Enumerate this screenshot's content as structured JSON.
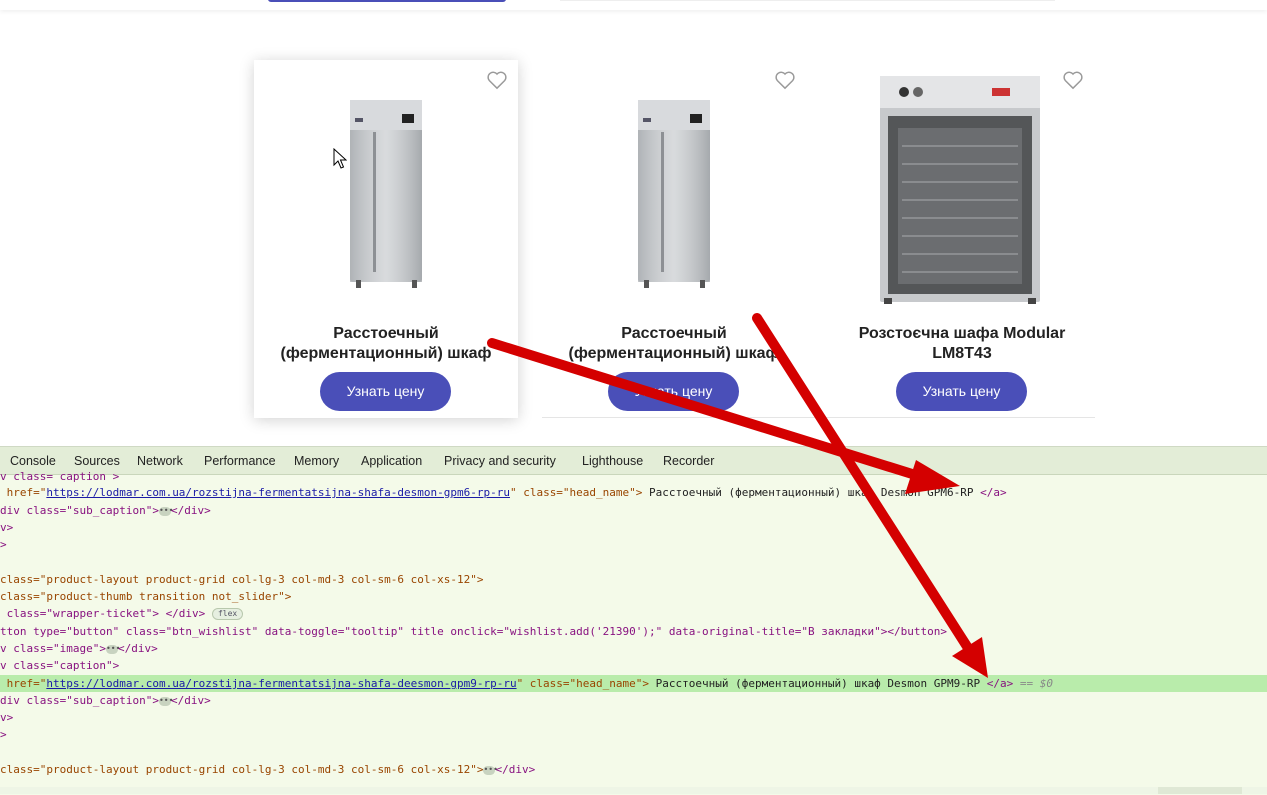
{
  "products": [
    {
      "name": "Расстоечный (ферментационный) шкаф",
      "button": "Узнать цену"
    },
    {
      "name": "Расстоечный (ферментационный) шкаф",
      "button": "Узнать цену"
    },
    {
      "name": "Розстоєчна шафа Modular LM8T43",
      "button": "Узнать цену"
    }
  ],
  "devtools": {
    "tabs": [
      "Console",
      "Sources",
      "Network",
      "Performance",
      "Memory",
      "Application",
      "Privacy and security",
      "Lighthouse",
      "Recorder"
    ],
    "lines": {
      "l0": "v class= caption >",
      "l1_pre": " href=\"",
      "l1_url": "https://lodmar.com.ua/rozstijna-fermentatsijna-shafa-desmon-gpm6-rp-ru",
      "l1_mid": "\" class=\"head_name\"> ",
      "l1_text": "Расстоечный (ферментационный) шкаф Desmon GPM6-RP",
      "l1_end": " </a>",
      "l2": "div class=\"sub_caption\">",
      "l2_end": "</div>",
      "l3": "v>",
      "l4": ">",
      "l5": "class=\"product-layout product-grid col-lg-3 col-md-3 col-sm-6 col-xs-12\">",
      "l6": "class=\"product-thumb transition not_slider\">",
      "l7": " class=\"wrapper-ticket\"> </div>",
      "l7_badge": "flex",
      "l8": "tton type=\"button\" class=\"btn_wishlist\" data-toggle=\"tooltip\" title onclick=\"wishlist.add('21390');\" data-original-title=\"В закладки\"></button>",
      "l9": "v class=\"image\">",
      "l9_end": "</div>",
      "l10": "v class=\"caption\">",
      "l11_pre": " href=\"",
      "l11_url": "https://lodmar.com.ua/rozstijna-fermentatsijna-shafa-deesmon-gpm9-rp-ru",
      "l11_mid": "\" class=\"head_name\"> ",
      "l11_text": "Расстоечный (ферментационный) шкаф Desmon GPM9-RP",
      "l11_end": " </a>",
      "l11_sel": " == $0",
      "l12": "div class=\"sub_caption\">",
      "l12_end": "</div>",
      "l13": "v>",
      "l14": ">",
      "l15": "class=\"product-layout product-grid col-lg-3 col-md-3 col-sm-6 col-xs-12\">",
      "l15_end": "</div>"
    }
  },
  "colors": {
    "accent": "#4a4fb8",
    "annotation": "#d40000",
    "highlight": "#b9ecab"
  }
}
